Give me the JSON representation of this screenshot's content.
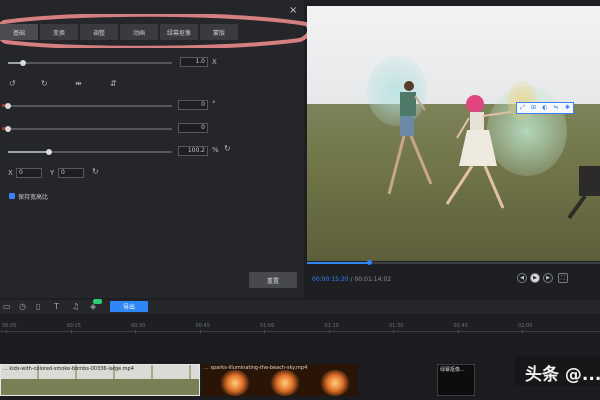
{
  "panel": {
    "close": "×",
    "tabs": [
      "基础",
      "变换",
      "调整",
      "动画",
      "绿幕抠像",
      "蒙版"
    ],
    "speed": {
      "value": "1.0",
      "unit": "X"
    },
    "rotate": {
      "value": "0",
      "unit": "°"
    },
    "opacity": {
      "value": "0"
    },
    "scale": {
      "value": "100.2",
      "unit": "%"
    },
    "position": {
      "x_label": "X",
      "x_value": "0",
      "y_label": "Y",
      "y_value": "0"
    },
    "keep_ratio_label": "保持宽高比",
    "reset_label": "重置"
  },
  "player": {
    "current_time": "00:00:15:20",
    "total_time": "00:01:14:02",
    "progress": 0.21,
    "toolbar_icons": [
      "resize-icon",
      "crop-icon",
      "flip-icon",
      "mirror-icon",
      "settings-icon"
    ]
  },
  "timeline": {
    "export_label": "导出",
    "ruler": [
      "00:00",
      "00:15",
      "00:30",
      "00:45",
      "01:00",
      "01:15",
      "01:30",
      "01:45",
      "02:00"
    ],
    "clips": [
      {
        "title": "... kids-with-colored-smoke-bombs-00336-large.mp4"
      },
      {
        "title": "... sparks-illuminating-the-beach-sky.mp4"
      },
      {
        "title": "绿幕抠像..."
      }
    ]
  },
  "watermark": "头条 @..."
}
